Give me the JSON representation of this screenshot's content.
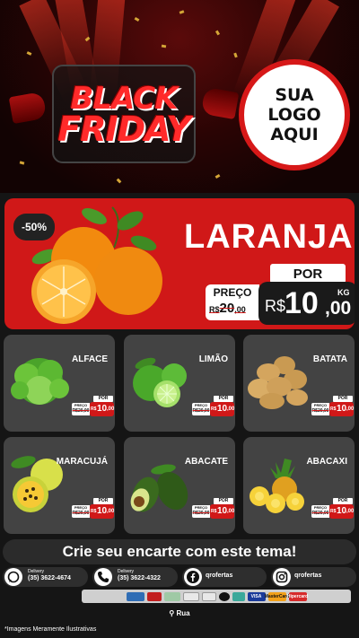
{
  "header": {
    "title_black": "BLACK",
    "title_friday": "FRIDAY",
    "logo_line1": "SUA",
    "logo_line2": "LOGO",
    "logo_line3": "AQUI"
  },
  "featured": {
    "discount": "-50%",
    "name": "LARANJA",
    "por": "POR",
    "preco_label": "PREÇO",
    "old_price_cur": "R$",
    "old_price_int": "20",
    "old_price_dec": ",00",
    "currency": "R$",
    "price_int": "10",
    "price_dec": ",00",
    "unit": "KG"
  },
  "products": [
    {
      "name": "ALFACE",
      "por": "POR",
      "preco": "PREÇO",
      "old": "R$20,00",
      "cur": "R$",
      "int": "10",
      "dec": ",00"
    },
    {
      "name": "LIMÃO",
      "por": "POR",
      "preco": "PREÇO",
      "old": "R$20,00",
      "cur": "R$",
      "int": "10",
      "dec": ",00"
    },
    {
      "name": "BATATA",
      "por": "POR",
      "preco": "PREÇO",
      "old": "R$20,00",
      "cur": "R$",
      "int": "10",
      "dec": ",00"
    },
    {
      "name": "MARACUJÁ",
      "por": "POR",
      "preco": "PREÇO",
      "old": "R$20,00",
      "cur": "R$",
      "int": "10",
      "dec": ",00"
    },
    {
      "name": "ABACATE",
      "por": "POR",
      "preco": "PREÇO",
      "old": "R$20,00",
      "cur": "R$",
      "int": "10",
      "dec": ",00"
    },
    {
      "name": "ABACAXI",
      "por": "POR",
      "preco": "PREÇO",
      "old": "R$20,00",
      "cur": "R$",
      "int": "10",
      "dec": ",00"
    }
  ],
  "cta": "Crie seu encarte com este tema!",
  "contacts": {
    "whatsapp_label": "Delivery",
    "whatsapp_number": "(35) 3622-4674",
    "phone_label": "Delivery",
    "phone_number": "(35) 3622-4322",
    "facebook": "qrofertas",
    "instagram": "qrofertas"
  },
  "payments": [
    "VISA",
    "MasterCard",
    "Hipercard",
    "Elo",
    "Pix",
    "Boleto"
  ],
  "address": "Rua",
  "disclaimer": "*Imagens Meramente Ilustrativas",
  "colors": {
    "accent": "#d01818",
    "card": "#434343",
    "background": "#151515"
  }
}
